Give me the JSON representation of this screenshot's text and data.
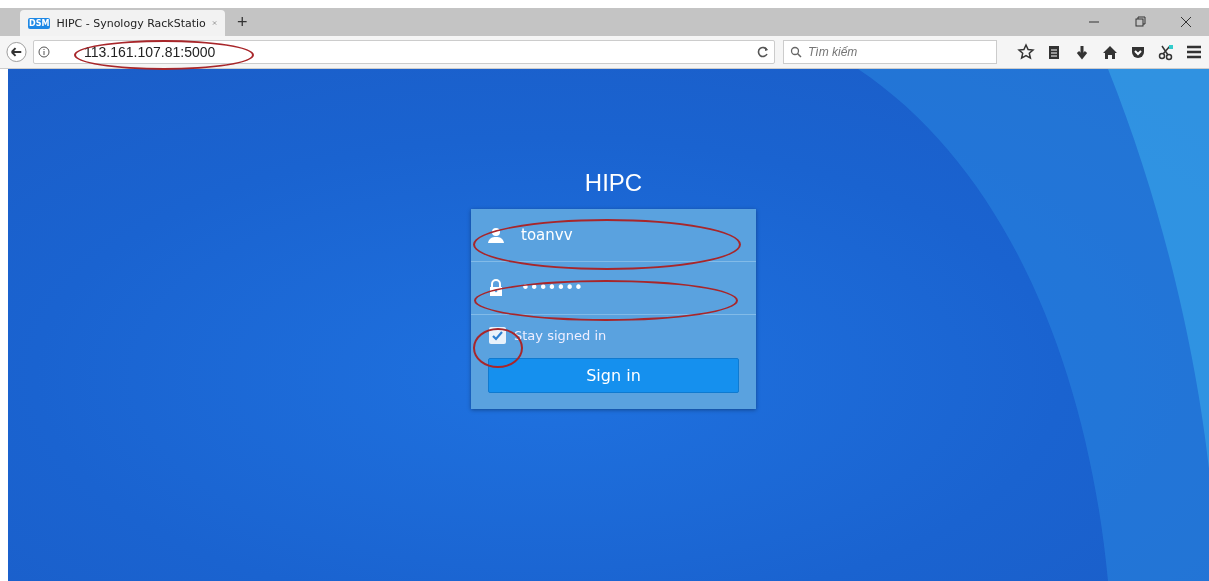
{
  "browser": {
    "tabs": [
      {
        "favicon": "DSM",
        "title": "HIPC - Synology RackStatio",
        "selected": true
      }
    ],
    "new_tab": "+",
    "address": {
      "text": "113.161.107.81:5000",
      "circled": true
    },
    "search": {
      "placeholder": "Tìm kiếm"
    }
  },
  "login": {
    "title": "HIPC",
    "username": {
      "value": "toanvv",
      "circled": true
    },
    "password": {
      "value": "•••••••",
      "circled": true
    },
    "stay_signed_in": {
      "label": "Stay signed in",
      "checked": true,
      "circled": true
    },
    "button": "Sign in"
  }
}
